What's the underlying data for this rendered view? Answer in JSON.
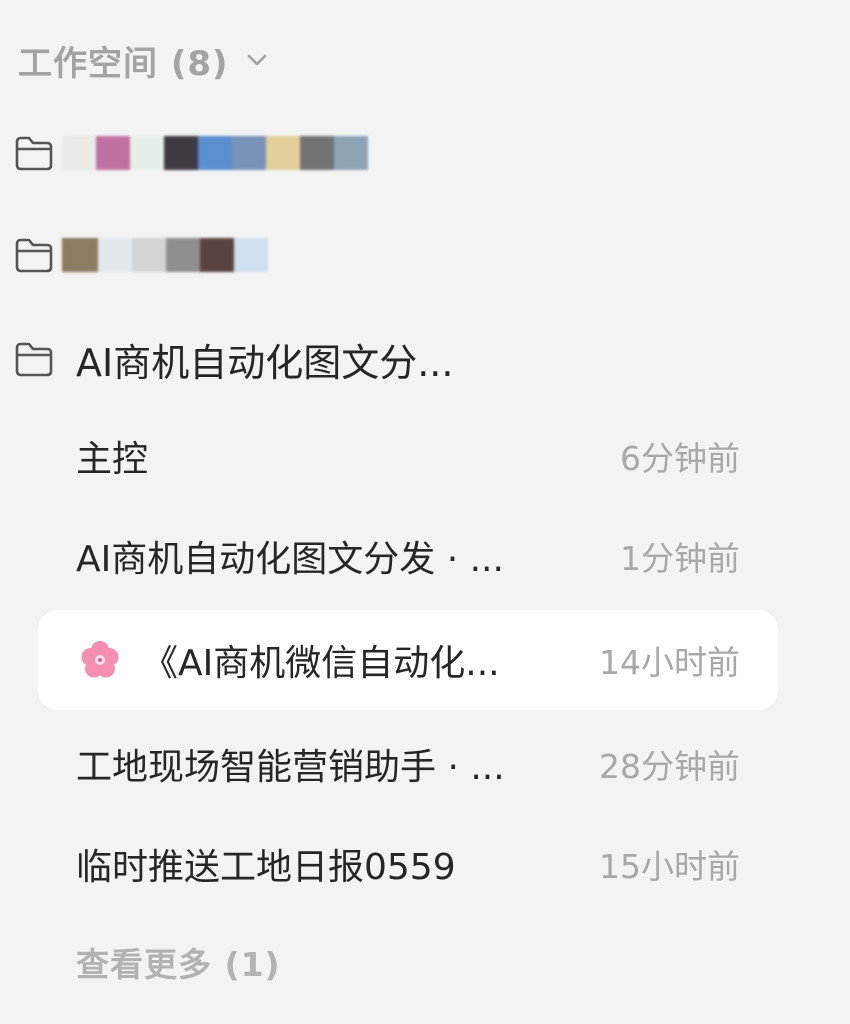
{
  "header": {
    "title": "工作空间 (8)",
    "chevron_icon": "chevron-down-icon"
  },
  "folders": [
    {
      "label": "",
      "icon": "folder-icon",
      "redacted": true
    },
    {
      "label": "",
      "icon": "folder-icon",
      "redacted": true
    },
    {
      "label": "AI商机自动化图文分...",
      "icon": "folder-icon",
      "redacted": false
    }
  ],
  "sessions": [
    {
      "title": "主控",
      "time": "6分钟前"
    },
    {
      "title": "AI商机自动化图文分发 · ...",
      "time": "1分钟前"
    },
    {
      "title": "《AI商机微信自动化...",
      "time": "14小时前",
      "icon": "cherry-blossom-icon",
      "active": true
    },
    {
      "title": "工地现场智能营销助手 · ...",
      "time": "28分钟前"
    },
    {
      "title": "临时推送工地日报0559",
      "time": "15小时前"
    }
  ],
  "footer": {
    "more_label": "查看更多 (1)"
  },
  "colors": {
    "background": "#f3f3f3",
    "active_row": "#ffffff",
    "muted_text": "#a8a8a8",
    "primary_text": "#262626",
    "redact_1": [
      "#e9ece7",
      "#c070a0",
      "#e6efe8",
      "#403a42",
      "#5a8fd0",
      "#7893b8",
      "#e2cf9a",
      "#737373",
      "#8fa3b6"
    ],
    "redact_2": [
      "#8a7c62",
      "#e3e8ec",
      "#d4d4d4",
      "#8f8f8f",
      "#5a4240",
      "#cfe0ee"
    ]
  }
}
